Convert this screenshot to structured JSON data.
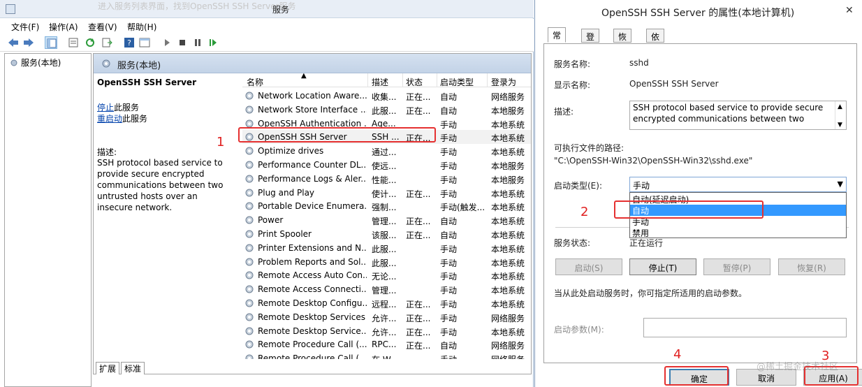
{
  "services_window": {
    "title": "服务",
    "ghost_text": "进入服务列表界面，找到OpenSSH SSH Server服务",
    "menu": [
      "文件(F)",
      "操作(A)",
      "查看(V)",
      "帮助(H)"
    ],
    "tree_root": "服务(本地)",
    "panel_header": "服务(本地)",
    "selected_service": {
      "name": "OpenSSH SSH Server",
      "stop_link": "停止",
      "stop_suffix": "此服务",
      "restart_link": "重启动",
      "restart_suffix": "此服务",
      "desc_label": "描述:",
      "desc_text": "SSH protocol based service to provide secure encrypted communications between two untrusted hosts over an insecure network."
    },
    "columns": {
      "name": "名称",
      "desc": "描述",
      "status": "状态",
      "startup": "启动类型",
      "logon": "登录为"
    },
    "rows": [
      {
        "name": "Network Location Aware...",
        "desc": "收集...",
        "status": "正在...",
        "startup": "自动",
        "logon": "网络服务"
      },
      {
        "name": "Network Store Interface ...",
        "desc": "此服...",
        "status": "正在...",
        "startup": "自动",
        "logon": "本地服务"
      },
      {
        "name": "OpenSSH Authentication ...",
        "desc": "Age...",
        "status": "",
        "startup": "手动",
        "logon": "本地系统"
      },
      {
        "name": "OpenSSH SSH Server",
        "desc": "SSH ...",
        "status": "正在...",
        "startup": "手动",
        "logon": "本地系统"
      },
      {
        "name": "Optimize drives",
        "desc": "通过...",
        "status": "",
        "startup": "手动",
        "logon": "本地系统"
      },
      {
        "name": "Performance Counter DL...",
        "desc": "使远...",
        "status": "",
        "startup": "手动",
        "logon": "本地服务"
      },
      {
        "name": "Performance Logs & Aler...",
        "desc": "性能...",
        "status": "",
        "startup": "手动",
        "logon": "本地服务"
      },
      {
        "name": "Plug and Play",
        "desc": "使计...",
        "status": "正在...",
        "startup": "手动",
        "logon": "本地系统"
      },
      {
        "name": "Portable Device Enumera...",
        "desc": "强制...",
        "status": "",
        "startup": "手动(触发...",
        "logon": "本地系统"
      },
      {
        "name": "Power",
        "desc": "管理...",
        "status": "正在...",
        "startup": "自动",
        "logon": "本地系统"
      },
      {
        "name": "Print Spooler",
        "desc": "该服...",
        "status": "正在...",
        "startup": "自动",
        "logon": "本地系统"
      },
      {
        "name": "Printer Extensions and N...",
        "desc": "此服...",
        "status": "",
        "startup": "手动",
        "logon": "本地系统"
      },
      {
        "name": "Problem Reports and Sol...",
        "desc": "此服...",
        "status": "",
        "startup": "手动",
        "logon": "本地系统"
      },
      {
        "name": "Remote Access Auto Con...",
        "desc": "无论...",
        "status": "",
        "startup": "手动",
        "logon": "本地系统"
      },
      {
        "name": "Remote Access Connecti...",
        "desc": "管理...",
        "status": "",
        "startup": "手动",
        "logon": "本地系统"
      },
      {
        "name": "Remote Desktop Configu...",
        "desc": "远程...",
        "status": "正在...",
        "startup": "手动",
        "logon": "本地系统"
      },
      {
        "name": "Remote Desktop Services",
        "desc": "允许...",
        "status": "正在...",
        "startup": "手动",
        "logon": "网络服务"
      },
      {
        "name": "Remote Desktop Service...",
        "desc": "允许...",
        "status": "正在...",
        "startup": "手动",
        "logon": "本地系统"
      },
      {
        "name": "Remote Procedure Call (...",
        "desc": "RPC...",
        "status": "正在...",
        "startup": "自动",
        "logon": "网络服务"
      },
      {
        "name": "Remote Procedure Call (...",
        "desc": "在 W...",
        "status": "",
        "startup": "手动",
        "logon": "网络服务"
      }
    ],
    "bottom_tabs": [
      "扩展",
      "标准"
    ]
  },
  "dialog": {
    "title": "OpenSSH SSH Server 的属性(本地计算机)",
    "close": "✕",
    "tabs": [
      "常规",
      "登录",
      "恢复",
      "依存关系"
    ],
    "service_name_label": "服务名称:",
    "service_name": "sshd",
    "display_name_label": "显示名称:",
    "display_name": "OpenSSH SSH Server",
    "desc_label": "描述:",
    "desc_text": "SSH protocol based service to provide secure encrypted communications between two",
    "path_label": "可执行文件的路径:",
    "path": "\"C:\\OpenSSH-Win32\\OpenSSH-Win32\\sshd.exe\"",
    "startup_label": "启动类型(E):",
    "startup_value": "手动",
    "startup_options": [
      "自动(延迟启动)",
      "自动",
      "手动",
      "禁用"
    ],
    "status_label": "服务状态:",
    "status_value": "正在运行",
    "buttons": {
      "start": "启动(S)",
      "stop": "停止(T)",
      "pause": "暂停(P)",
      "resume": "恢复(R)"
    },
    "hint": "当从此处启动服务时，你可指定所适用的启动参数。",
    "param_label": "启动参数(M):",
    "param_value": "",
    "footer": {
      "ok": "确定",
      "cancel": "取消",
      "apply": "应用(A)"
    }
  },
  "annotations": {
    "one": "1",
    "two": "2",
    "three": "3",
    "four": "4"
  },
  "watermark": "@稀土掘金技术社区",
  "colors": {
    "annotation_red": "#e53030",
    "selection_blue": "#3399ff"
  }
}
